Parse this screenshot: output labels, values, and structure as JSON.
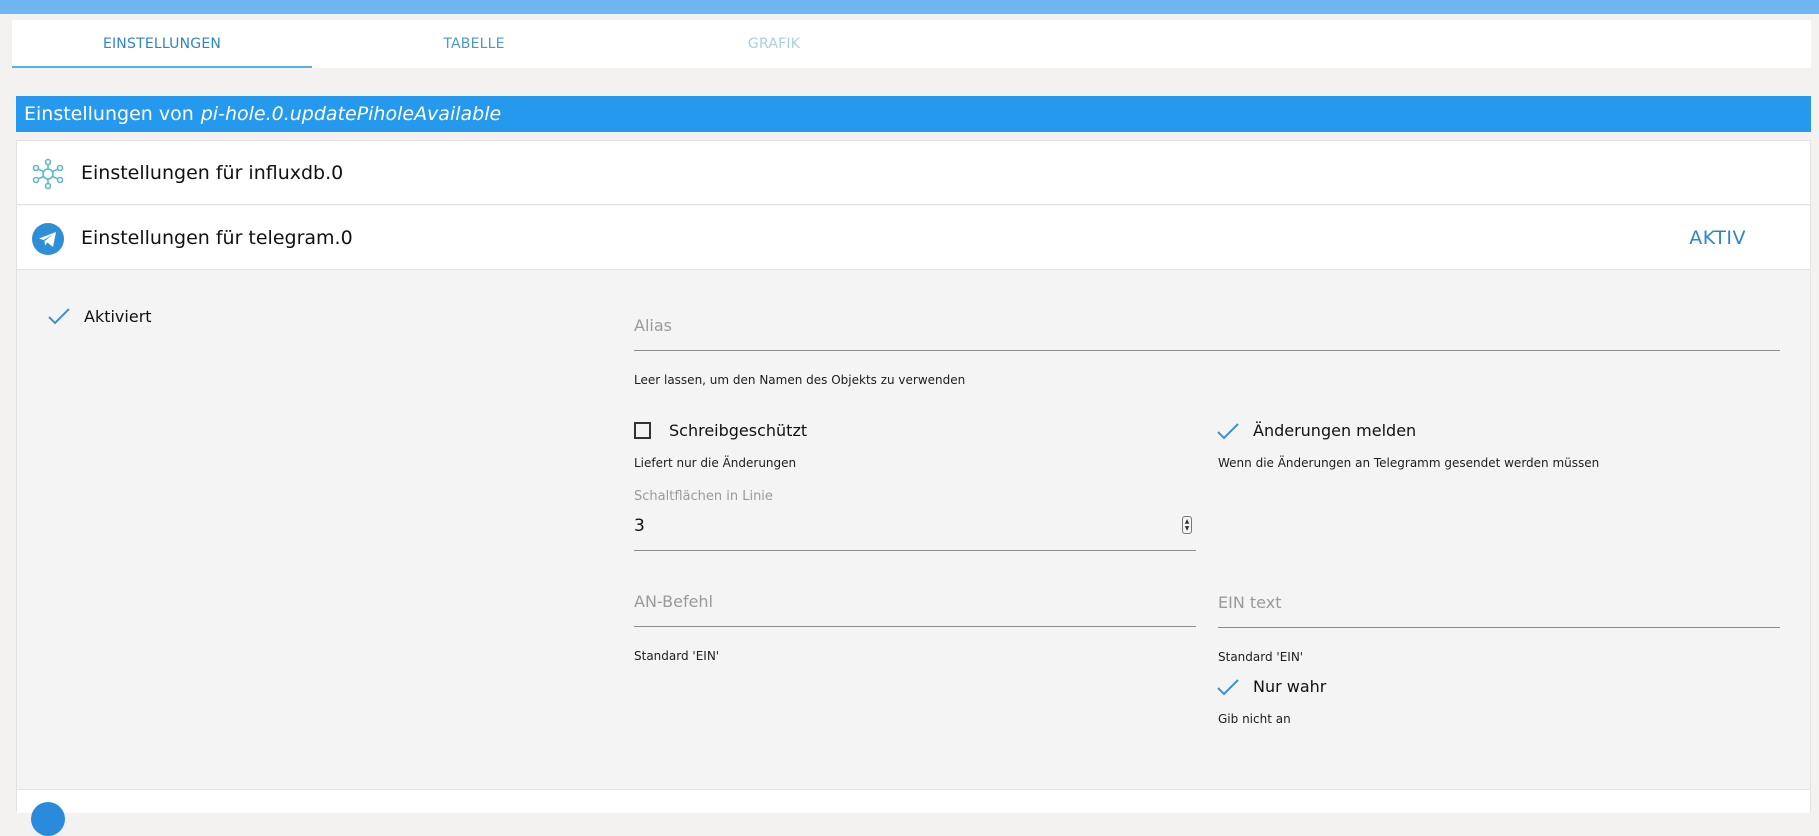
{
  "tabs": {
    "settings": "EINSTELLUNGEN",
    "table": "TABELLE",
    "chart": "GRAFIK"
  },
  "header": {
    "prefix": "Einstellungen von",
    "object_id": "pi-hole.0.updatePiholeAvailable"
  },
  "adapters": {
    "influx": {
      "title": "Einstellungen für influxdb.0",
      "icon": "influxdb-icon"
    },
    "telegram": {
      "title": "Einstellungen für telegram.0",
      "status": "AKTIV",
      "icon": "telegram-icon"
    }
  },
  "telegram_settings": {
    "enabled_label": "Aktiviert",
    "alias_placeholder": "Alias",
    "alias_hint": "Leer lassen, um den Namen des Objekts zu verwenden",
    "readonly_label": "Schreibgeschützt",
    "readonly_hint": "Liefert nur die Änderungen",
    "report_changes_label": "Änderungen melden",
    "report_changes_hint": "Wenn die Änderungen an Telegramm gesendet werden müssen",
    "buttons_per_line_label": "Schaltflächen in Linie",
    "buttons_per_line_value": "3",
    "on_command_placeholder": "AN-Befehl",
    "on_command_hint": "Standard 'EIN'",
    "on_text_placeholder": "EIN text",
    "on_text_hint": "Standard 'EIN'",
    "only_true_label": "Nur wahr",
    "only_true_hint": "Gib nicht an"
  },
  "colors": {
    "accent": "#2599ee",
    "tab_active": "#2f86c6",
    "top_strip": "#6fb6f0"
  }
}
